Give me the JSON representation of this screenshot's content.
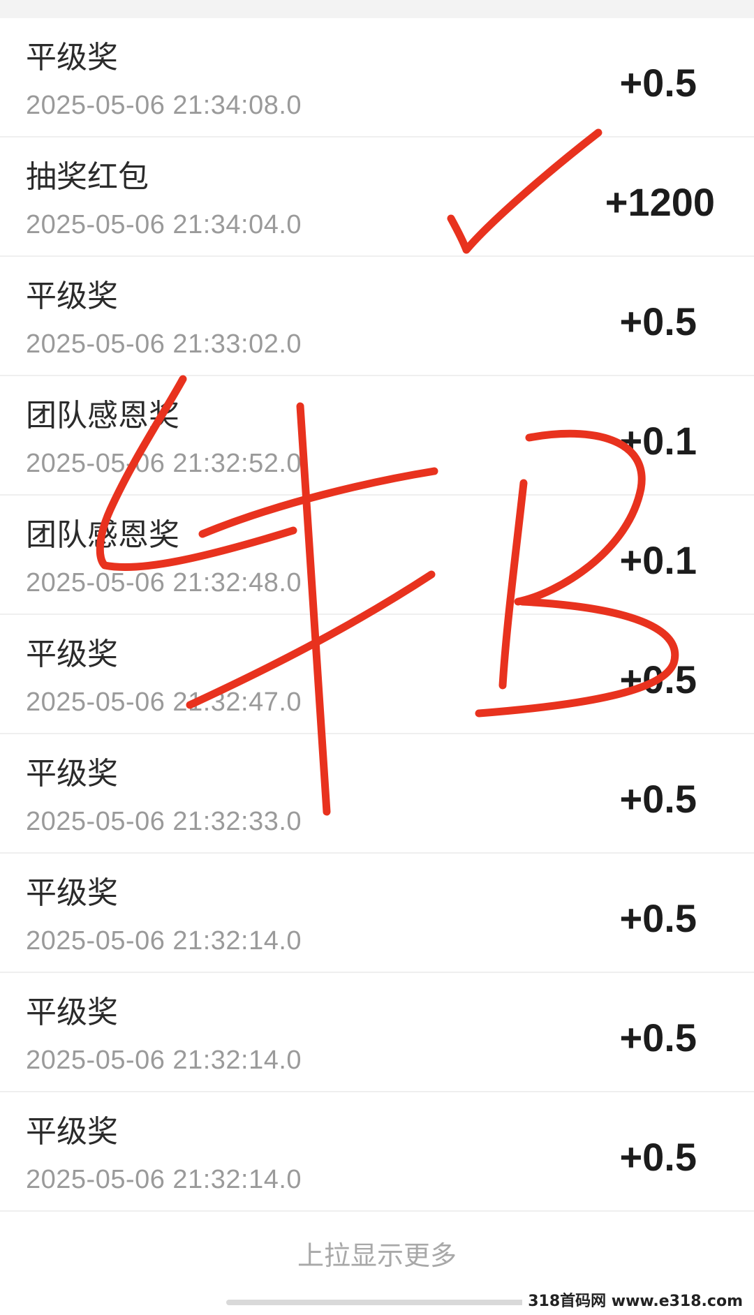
{
  "records": [
    {
      "title": "平级奖",
      "time": "2025-05-06 21:34:08.0",
      "amount": "+0.5"
    },
    {
      "title": "抽奖红包",
      "time": "2025-05-06 21:34:04.0",
      "amount": "+1200"
    },
    {
      "title": "平级奖",
      "time": "2025-05-06 21:33:02.0",
      "amount": "+0.5"
    },
    {
      "title": "团队感恩奖",
      "time": "2025-05-06 21:32:52.0",
      "amount": "+0.1"
    },
    {
      "title": "团队感恩奖",
      "time": "2025-05-06 21:32:48.0",
      "amount": "+0.1"
    },
    {
      "title": "平级奖",
      "time": "2025-05-06 21:32:47.0",
      "amount": "+0.5"
    },
    {
      "title": "平级奖",
      "time": "2025-05-06 21:32:33.0",
      "amount": "+0.5"
    },
    {
      "title": "平级奖",
      "time": "2025-05-06 21:32:14.0",
      "amount": "+0.5"
    },
    {
      "title": "平级奖",
      "time": "2025-05-06 21:32:14.0",
      "amount": "+0.5"
    },
    {
      "title": "平级奖",
      "time": "2025-05-06 21:32:14.0",
      "amount": "+0.5"
    }
  ],
  "footer": {
    "load_more": "上拉显示更多"
  },
  "watermark": {
    "text": "318首码网 www.e318.com"
  },
  "annotation": {
    "ink_color": "#e8321e"
  }
}
